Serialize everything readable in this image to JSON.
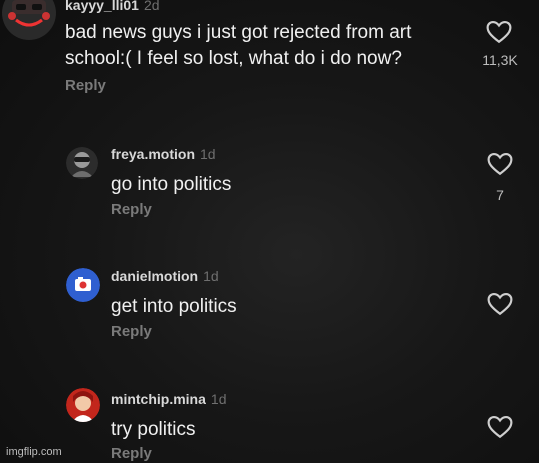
{
  "comments": [
    {
      "username": "kayyy_lli01",
      "time": "2d",
      "text_line1": "bad news guys i just got rejected from art",
      "text_line2": "school:( I feel so lost, what do i do now?",
      "reply": "Reply",
      "likes": "11,3K"
    },
    {
      "username": "freya.motion",
      "time": "1d",
      "text": "go into politics",
      "reply": "Reply",
      "likes": "7"
    },
    {
      "username": "danielmotion",
      "time": "1d",
      "text": "get into politics",
      "reply": "Reply"
    },
    {
      "username": "mintchip.mina",
      "time": "1d",
      "text": "try politics",
      "reply": "Reply"
    }
  ],
  "watermark": "imgflip.com",
  "colors": {
    "background": "#121212",
    "text": "#f0f0f0",
    "muted": "#7a7a7a",
    "heart": "#cfcfcf"
  }
}
